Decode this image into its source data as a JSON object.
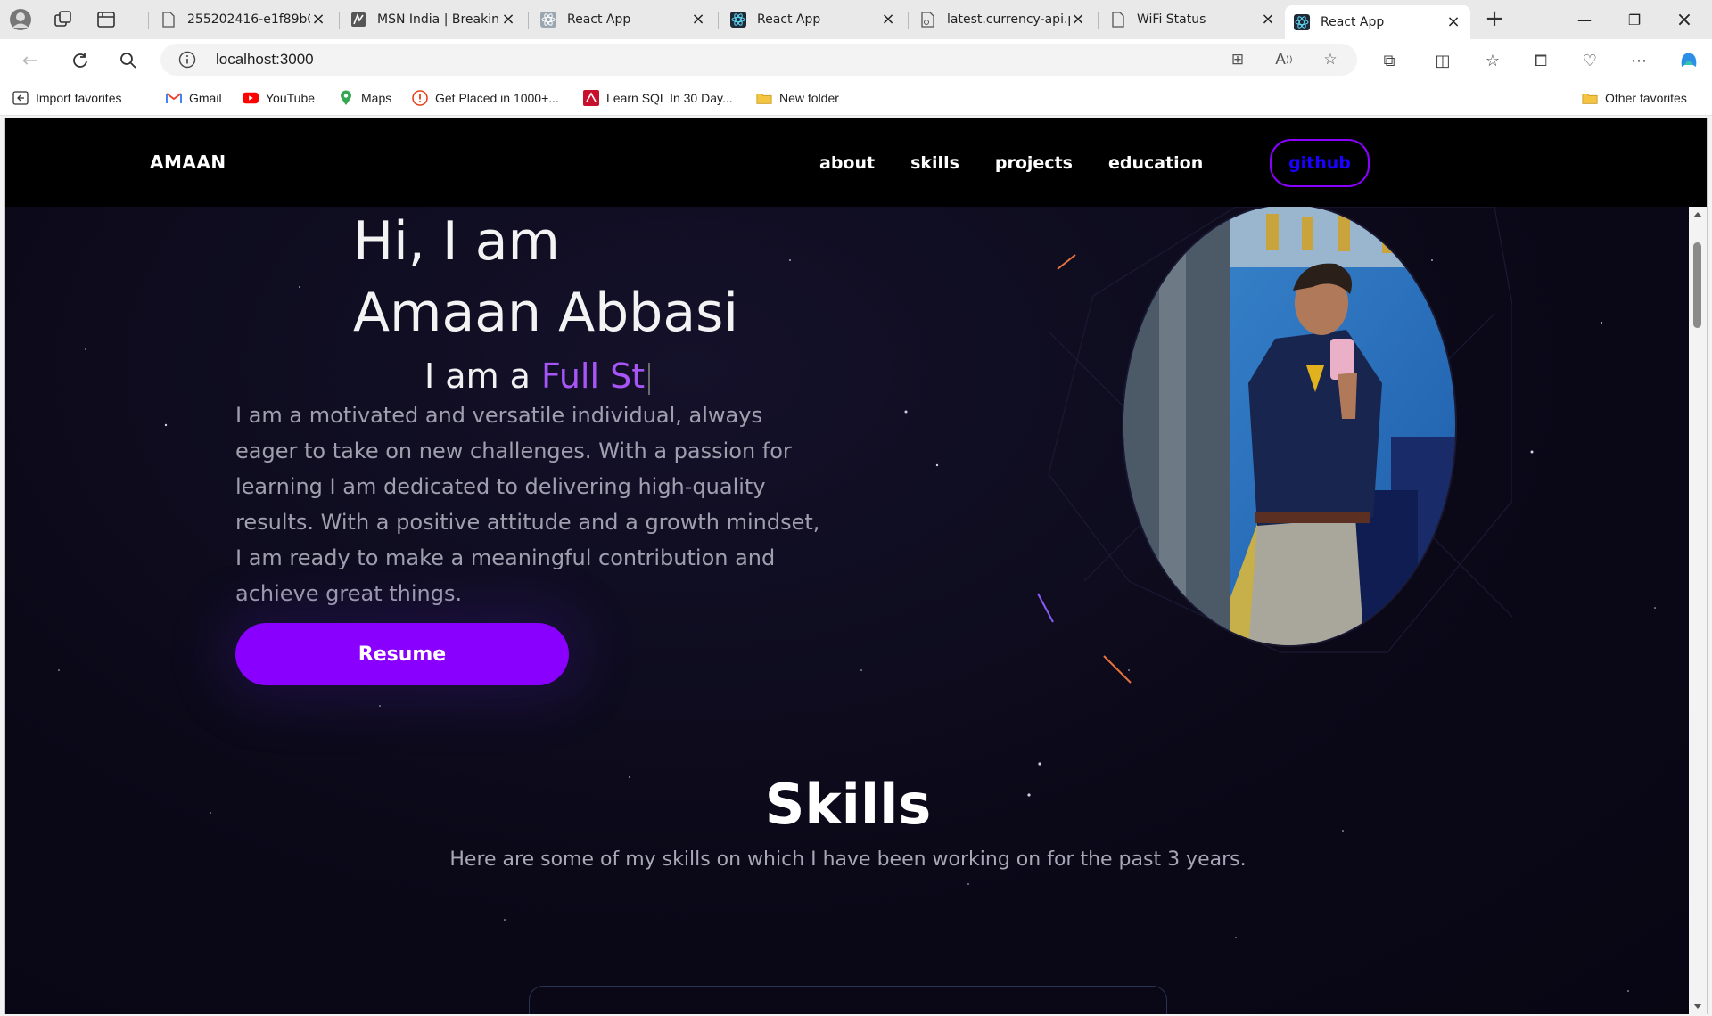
{
  "browser": {
    "tabs": [
      {
        "label": "255202416-e1f89b0",
        "icon": "file-icon"
      },
      {
        "label": "MSN India | Breakin",
        "icon": "msn-icon"
      },
      {
        "label": "React App",
        "icon": "react-icon"
      },
      {
        "label": "React App",
        "icon": "react-icon"
      },
      {
        "label": "latest.currency-api.p",
        "icon": "link-file-icon"
      },
      {
        "label": "WiFi Status",
        "icon": "file-icon"
      },
      {
        "label": "React App",
        "icon": "react-icon",
        "active": true
      }
    ],
    "url": "localhost:3000",
    "bookmarks": [
      {
        "label": "Import favorites",
        "icon": "import-icon"
      },
      {
        "label": "Gmail",
        "icon": "gmail-icon"
      },
      {
        "label": "YouTube",
        "icon": "youtube-icon"
      },
      {
        "label": "Maps",
        "icon": "maps-icon"
      },
      {
        "label": "Get Placed in 1000+...",
        "icon": "alert-icon"
      },
      {
        "label": "Learn SQL In 30 Day...",
        "icon": "sql-icon"
      },
      {
        "label": "New folder",
        "icon": "folder-icon"
      }
    ],
    "other_favorites": "Other favorites"
  },
  "site": {
    "logo": "AMAAN",
    "nav": [
      "about",
      "skills",
      "projects",
      "education"
    ],
    "github": "github",
    "hero": {
      "greeting": "Hi, I am",
      "name": "Amaan Abbasi",
      "role_prefix": "I am a ",
      "role_typed": "Full St",
      "description": "I am a motivated and versatile individual, always eager to take on new challenges. With a passion for learning I am dedicated to delivering high-quality results. With a positive attitude and a growth mindset, I am ready to make a meaningful contribution and achieve great things.",
      "resume_button": "Resume"
    },
    "skills": {
      "title": "Skills",
      "subtitle": "Here are some of my skills on which I have been working on for the past 3 years."
    }
  },
  "colors": {
    "accent_purple": "#8a00ff",
    "role_accent": "#a855f7",
    "github_text": "#1a00ff",
    "page_bg": "#0a0815"
  }
}
